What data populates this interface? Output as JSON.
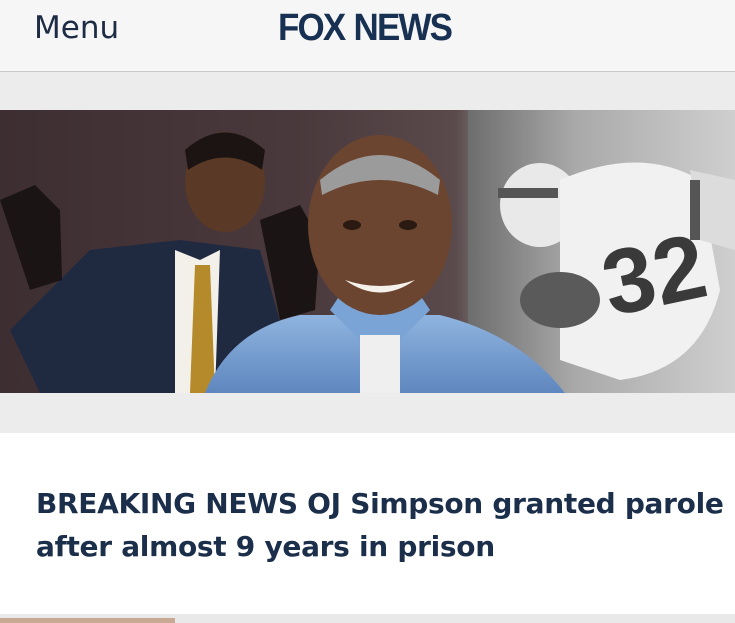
{
  "header": {
    "menu_label": "Menu",
    "logo_text_left": "FOX",
    "logo_text_right": "NEWS"
  },
  "article": {
    "headline": "BREAKING NEWS OJ Simpson granted parole after almost 9 years in prison"
  },
  "colors": {
    "brand_navy": "#183153",
    "headline": "#1b2e4a",
    "header_bg": "#f6f6f6"
  }
}
